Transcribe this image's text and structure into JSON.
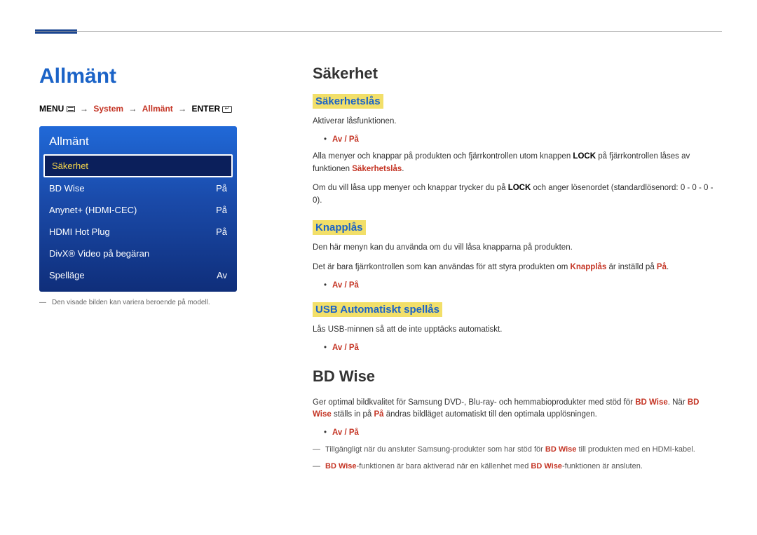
{
  "left": {
    "page_title": "Allmänt",
    "breadcrumb": {
      "menu_label": "MENU",
      "system": "System",
      "allmant": "Allmänt",
      "enter_label": "ENTER"
    },
    "osd": {
      "header": "Allmänt",
      "rows": [
        {
          "label": "Säkerhet",
          "value": "",
          "selected": true
        },
        {
          "label": "BD Wise",
          "value": "På",
          "selected": false
        },
        {
          "label": "Anynet+ (HDMI-CEC)",
          "value": "På",
          "selected": false
        },
        {
          "label": "HDMI Hot Plug",
          "value": "På",
          "selected": false
        },
        {
          "label": "DivX® Video på begäran",
          "value": "",
          "selected": false
        },
        {
          "label": "Spelläge",
          "value": "Av",
          "selected": false
        }
      ]
    },
    "caption": "Den visade bilden kan variera beroende på modell."
  },
  "right": {
    "security": {
      "title": "Säkerhet",
      "lock": {
        "title": "Säkerhetslås",
        "intro": "Aktiverar låsfunktionen.",
        "options": "Av / På",
        "p1_pre": "Alla menyer och knappar på produkten och fjärrkontrollen utom knappen ",
        "p1_bold": "LOCK",
        "p1_post": " på fjärrkontrollen låses av funktionen ",
        "p1_red": "Säkerhetslås",
        "p2_pre": "Om du vill låsa upp menyer och knappar trycker du på ",
        "p2_bold": "LOCK",
        "p2_post": " och anger lösenordet (standardlösenord: 0 - 0 - 0 - 0)."
      },
      "button_lock": {
        "title": "Knapplås",
        "p1": "Den här menyn kan du använda om du vill låsa knapparna på produkten.",
        "p2_pre": "Det är bara fjärrkontrollen som kan användas för att styra produkten om ",
        "p2_red": "Knapplås",
        "p2_mid": " är inställd på ",
        "p2_red2": "På",
        "options": "Av / På"
      },
      "usb_lock": {
        "title": "USB Automatiskt spellås",
        "p1": "Lås USB-minnen så att de inte upptäcks automatiskt.",
        "options": "Av / På"
      }
    },
    "bdwise": {
      "title": "BD Wise",
      "p1_pre": "Ger optimal bildkvalitet för Samsung DVD-, Blu-ray- och hemmabioprodukter med stöd för ",
      "p1_red": "BD Wise",
      "p1_mid": ". När ",
      "p1_red2": "BD Wise",
      "p1_mid2": " ställs in på ",
      "p1_red3": "På",
      "p1_post": " ändras bildläget automatiskt till den optimala upplösningen.",
      "options": "Av / På",
      "note1_pre": "Tillgängligt när du ansluter Samsung-produkter som har stöd för ",
      "note1_red": "BD Wise",
      "note1_post": " till produkten med en HDMI-kabel.",
      "note2_pre": "",
      "note2_red_a": "BD Wise",
      "note2_mid": "-funktionen är bara aktiverad när en källenhet med ",
      "note2_red_b": "BD Wise",
      "note2_post": "-funktionen är ansluten."
    }
  }
}
